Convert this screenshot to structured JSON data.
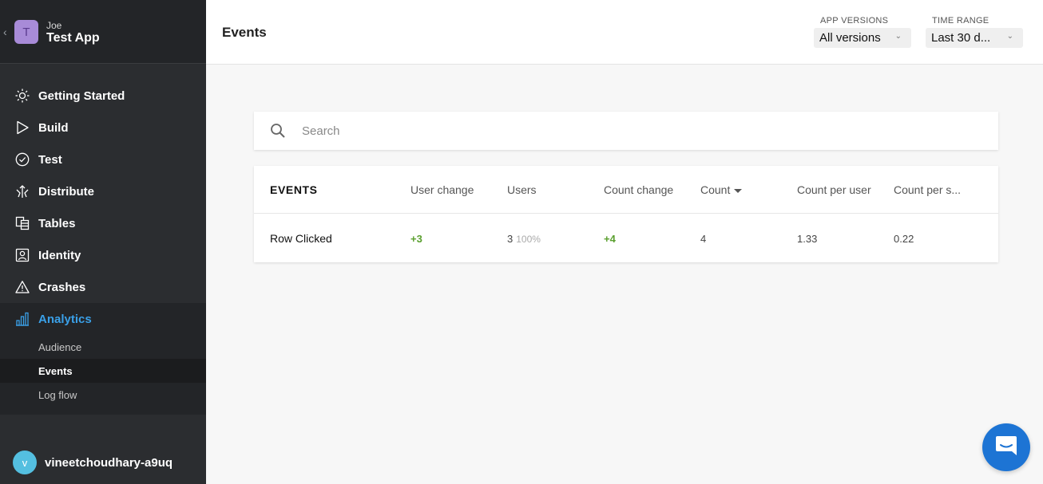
{
  "app": {
    "owner": "Joe",
    "name": "Test App",
    "avatar_letter": "T"
  },
  "nav": {
    "items": [
      {
        "label": "Getting Started",
        "icon": "sun-icon"
      },
      {
        "label": "Build",
        "icon": "play-icon"
      },
      {
        "label": "Test",
        "icon": "check-circle-icon"
      },
      {
        "label": "Distribute",
        "icon": "distribute-icon"
      },
      {
        "label": "Tables",
        "icon": "tables-icon"
      },
      {
        "label": "Identity",
        "icon": "identity-icon"
      },
      {
        "label": "Crashes",
        "icon": "warning-icon"
      },
      {
        "label": "Analytics",
        "icon": "bar-chart-icon"
      }
    ],
    "sub_items": [
      {
        "label": "Audience"
      },
      {
        "label": "Events"
      },
      {
        "label": "Log flow"
      }
    ]
  },
  "user": {
    "name": "vineetchoudhary-a9uq",
    "avatar_letter": "v"
  },
  "header": {
    "title": "Events",
    "app_versions_label": "APP VERSIONS",
    "app_versions_value": "All versions",
    "time_range_label": "TIME RANGE",
    "time_range_value": "Last 30 d..."
  },
  "search": {
    "placeholder": "Search"
  },
  "table": {
    "columns": [
      "EVENTS",
      "User change",
      "Users",
      "Count change",
      "Count",
      "Count per user",
      "Count per s..."
    ],
    "rows": [
      {
        "name": "Row Clicked",
        "user_change": "+3",
        "users": "3",
        "users_pct": "100%",
        "count_change": "+4",
        "count": "4",
        "count_per_user": "1.33",
        "count_per_session": "0.22"
      }
    ]
  },
  "colors": {
    "accent": "#3aa0e8",
    "positive": "#5a9f2e",
    "sidebar_bg": "#2b2d30",
    "chat_bg": "#1d74d4"
  }
}
